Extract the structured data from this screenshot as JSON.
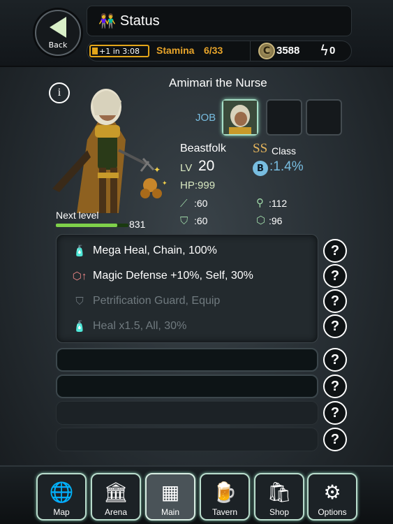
{
  "header": {
    "back_label": "Back",
    "title": "Status",
    "stamina_timer": "+1 in 3:08",
    "stamina_label": "Stamina",
    "stamina_value": "6/33",
    "coin_symbol": "C",
    "coins": "3588",
    "gems": "0"
  },
  "character": {
    "name": "Amimari the Nurse",
    "job_label": "JOB",
    "race": "Beastfolk",
    "class_rank": "SS",
    "class_label": "Class",
    "lv_label": "LV",
    "level": "20",
    "b_icon": "B",
    "b_value": ":1.4%",
    "hp": "HP:999",
    "atk": ":60",
    "mag": ":112",
    "def": ":60",
    "mdef": ":96",
    "next_level_label": "Next level",
    "next_level_exp": "831",
    "xp_progress": 0.85
  },
  "skills": [
    {
      "icon": "potion-icon",
      "label": "Mega Heal, Chain, 100%",
      "dim": false
    },
    {
      "icon": "magic-defense-up-icon",
      "label": "Magic Defense +10%, Self, 30%",
      "dim": false
    },
    {
      "icon": "guard-icon",
      "label": "Petrification Guard, Equip",
      "dim": true
    },
    {
      "icon": "potion-up-icon",
      "label": "Heal x1.5, All, 30%",
      "dim": true
    }
  ],
  "help_symbol": "?",
  "info_symbol": "i",
  "nav": [
    {
      "label": "Map",
      "icon": "globe-icon"
    },
    {
      "label": "Arena",
      "icon": "colosseum-icon"
    },
    {
      "label": "Main",
      "icon": "grid-icon"
    },
    {
      "label": "Tavern",
      "icon": "drinks-icon"
    },
    {
      "label": "Shop",
      "icon": "bag-icon"
    },
    {
      "label": "Options",
      "icon": "gears-icon"
    }
  ],
  "colors": {
    "accent_green": "#7fd14a",
    "stamina_orange": "#e9a52a",
    "job_blue": "#78bde0"
  }
}
